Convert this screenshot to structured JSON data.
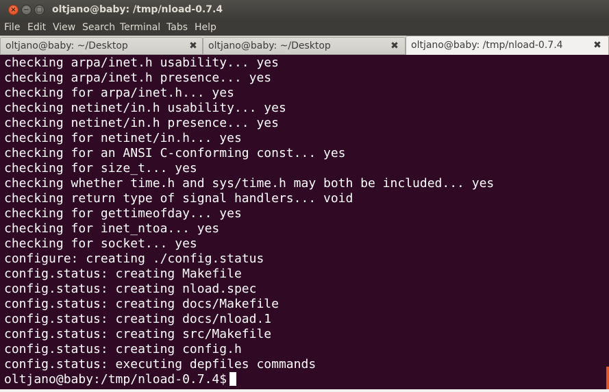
{
  "window": {
    "title": "oltjano@baby: /tmp/nload-0.7.4",
    "close_glyph": "×",
    "minimize_glyph": "−",
    "maximize_glyph": "□"
  },
  "menu": {
    "items": [
      "File",
      "Edit",
      "View",
      "Search",
      "Terminal",
      "Tabs",
      "Help"
    ]
  },
  "tabs": [
    {
      "label": "oltjano@baby: ~/Desktop",
      "close_glyph": "✖",
      "active": false
    },
    {
      "label": "oltjano@baby: ~/Desktop",
      "close_glyph": "✖",
      "active": false
    },
    {
      "label": "oltjano@baby: /tmp/nload-0.7.4",
      "close_glyph": "✖",
      "active": true
    }
  ],
  "terminal": {
    "lines": [
      "checking arpa/inet.h usability... yes",
      "checking arpa/inet.h presence... yes",
      "checking for arpa/inet.h... yes",
      "checking netinet/in.h usability... yes",
      "checking netinet/in.h presence... yes",
      "checking for netinet/in.h... yes",
      "checking for an ANSI C-conforming const... yes",
      "checking for size_t... yes",
      "checking whether time.h and sys/time.h may both be included... yes",
      "checking return type of signal handlers... void",
      "checking for gettimeofday... yes",
      "checking for inet_ntoa... yes",
      "checking for socket... yes",
      "configure: creating ./config.status",
      "config.status: creating Makefile",
      "config.status: creating nload.spec",
      "config.status: creating docs/Makefile",
      "config.status: creating docs/nload.1",
      "config.status: creating src/Makefile",
      "config.status: creating config.h",
      "config.status: executing depfiles commands"
    ],
    "prompt": "oltjano@baby:/tmp/nload-0.7.4$"
  },
  "colors": {
    "terminal_bg": "#300a24",
    "terminal_fg": "#ffffff",
    "accent": "#e95420"
  }
}
